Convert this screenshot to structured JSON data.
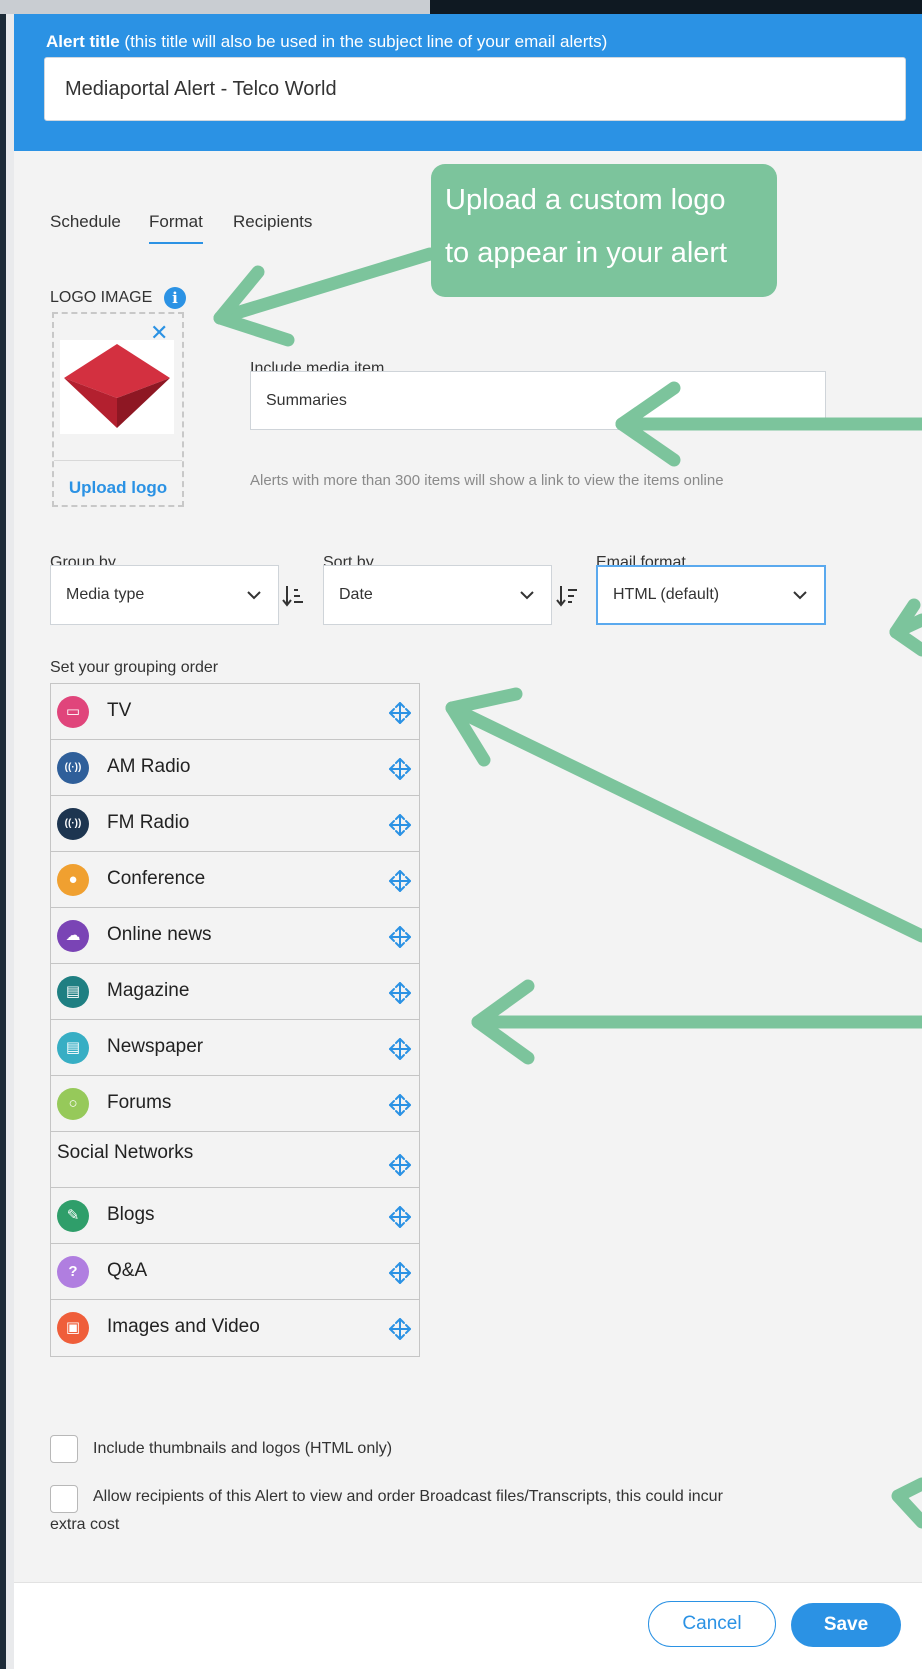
{
  "alert_title": {
    "label_bold": "Alert title",
    "label_rest": " (this title will also be used in the subject line of your email alerts)",
    "value": "Mediaportal Alert - Telco World"
  },
  "tabs": [
    {
      "label": "Schedule"
    },
    {
      "label": "Format"
    },
    {
      "label": "Recipients"
    }
  ],
  "logo": {
    "section_label": "LOGO IMAGE",
    "info_glyph": "i",
    "close_glyph": "✕",
    "upload_label": "Upload logo",
    "logo_colors": {
      "top": "#d33040",
      "bottom": "#9e1d2b"
    }
  },
  "include_media": {
    "label": "Include media item",
    "value": "Summaries",
    "hint": "Alerts with more than 300 items will show a link to view the items online"
  },
  "group_by": {
    "label": "Group by",
    "value": "Media type"
  },
  "sort_by": {
    "label": "Sort by",
    "value": "Date"
  },
  "email_format": {
    "label": "Email format",
    "value": "HTML (default)"
  },
  "grouping": {
    "label": "Set your grouping order",
    "items": [
      {
        "label": "TV",
        "icon": "tv-icon",
        "color": "#e0457b",
        "glyph": "▭"
      },
      {
        "label": "AM Radio",
        "icon": "am-radio-icon",
        "color": "#2f5f9a",
        "glyph": "((·))"
      },
      {
        "label": "FM Radio",
        "icon": "fm-radio-icon",
        "color": "#1d3550",
        "glyph": "((·))"
      },
      {
        "label": "Conference",
        "icon": "microphone-icon",
        "color": "#f0a030",
        "glyph": "●"
      },
      {
        "label": "Online news",
        "icon": "cloud-icon",
        "color": "#7a44b5",
        "glyph": "☁"
      },
      {
        "label": "Magazine",
        "icon": "magazine-icon",
        "color": "#1f7f82",
        "glyph": "▤"
      },
      {
        "label": "Newspaper",
        "icon": "newspaper-icon",
        "color": "#37aec4",
        "glyph": "▤"
      },
      {
        "label": "Forums",
        "icon": "forum-icon",
        "color": "#96c95a",
        "glyph": "○"
      },
      {
        "label": "Social Networks",
        "icon": "",
        "color": "",
        "glyph": ""
      },
      {
        "label": "Blogs",
        "icon": "pencil-icon",
        "color": "#2f9e6a",
        "glyph": "✎"
      },
      {
        "label": "Q&A",
        "icon": "question-icon",
        "color": "#b07ee0",
        "glyph": "?"
      },
      {
        "label": "Images and Video",
        "icon": "image-icon",
        "color": "#ef5e3a",
        "glyph": "▣"
      }
    ]
  },
  "options": {
    "thumbnails": "Include thumbnails and logos (HTML only)",
    "broadcast_line1": "Allow recipients of this Alert to view and order Broadcast files/Transcripts, this could incur",
    "broadcast_line2": "extra cost"
  },
  "buttons": {
    "cancel": "Cancel",
    "save": "Save"
  },
  "callout": {
    "line1": "Upload a custom logo",
    "line2": "to appear in your alert",
    "color": "#7cc49c"
  },
  "colors": {
    "accent": "#2b92e4",
    "annotation": "#7cc49c"
  }
}
